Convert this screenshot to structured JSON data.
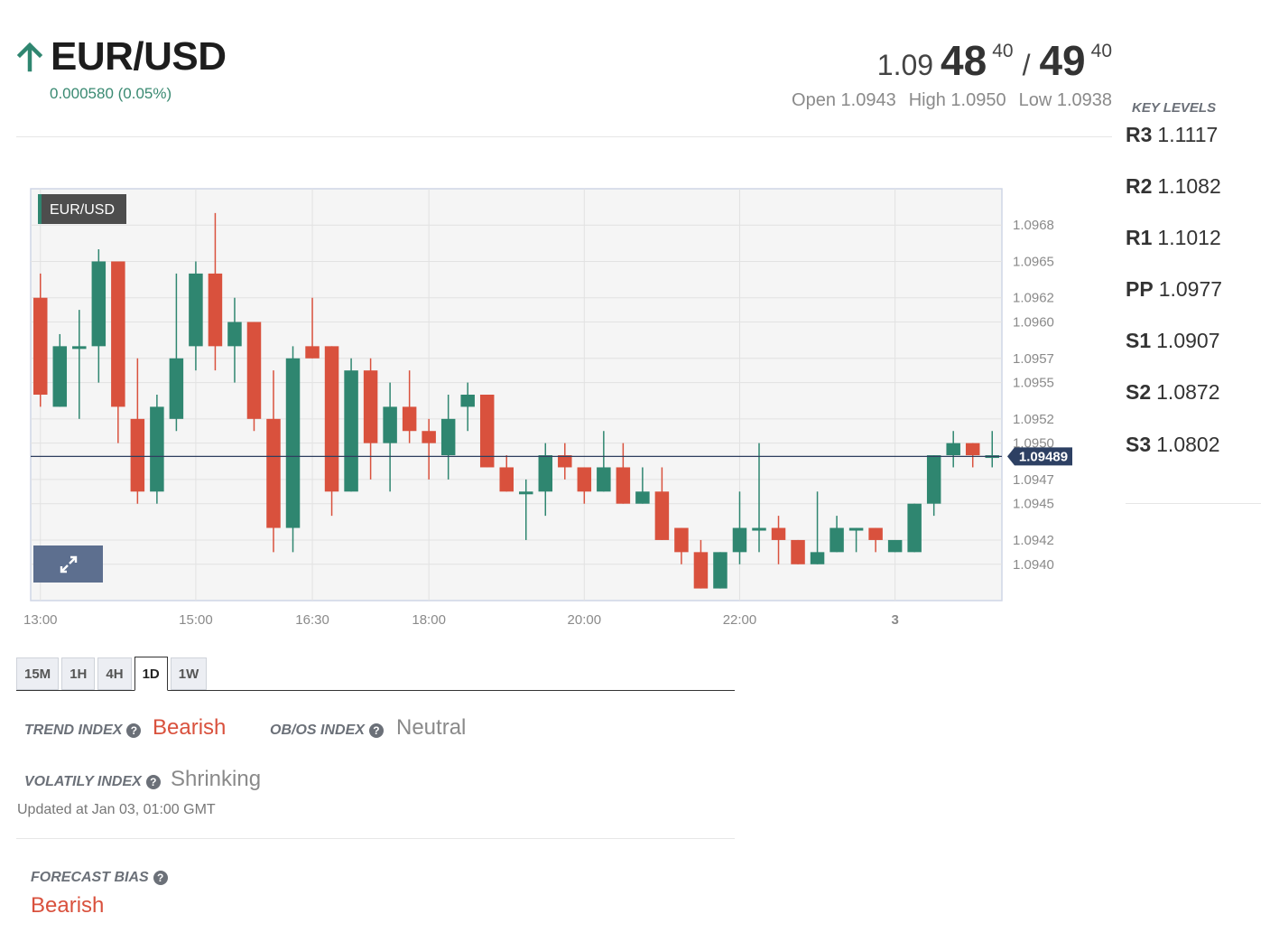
{
  "header": {
    "pair": "EUR/USD",
    "change": "0.000580 (0.05%)",
    "bid_prefix": "1.09",
    "bid_big": "48",
    "bid_sup": "40",
    "slash": "/",
    "ask_big": "49",
    "ask_sup": "40",
    "open": "Open 1.0943",
    "high": "High 1.0950",
    "low": "Low 1.0938"
  },
  "key_levels": {
    "title": "KEY LEVELS",
    "levels": [
      {
        "name": "R3",
        "value": "1.1117"
      },
      {
        "name": "R2",
        "value": "1.1082"
      },
      {
        "name": "R1",
        "value": "1.1012"
      },
      {
        "name": "PP",
        "value": "1.0977"
      },
      {
        "name": "S1",
        "value": "1.0907"
      },
      {
        "name": "S2",
        "value": "1.0872"
      },
      {
        "name": "S3",
        "value": "1.0802"
      }
    ]
  },
  "chart_data": {
    "type": "candlestick",
    "symbol_label": "EUR/USD",
    "current_price_label": "1.09489",
    "current_price": 1.09489,
    "ylim": [
      1.0937,
      1.0971
    ],
    "y_ticks": [
      "1.0968",
      "1.0965",
      "1.0962",
      "1.0960",
      "1.0957",
      "1.0955",
      "1.0952",
      "1.0950",
      "1.0947",
      "1.0945",
      "1.0942",
      "1.0940"
    ],
    "x_ticks": [
      {
        "label": "13:00",
        "index": 0.5
      },
      {
        "label": "15:00",
        "index": 8.5
      },
      {
        "label": "16:30",
        "index": 14.5
      },
      {
        "label": "18:00",
        "index": 20.5
      },
      {
        "label": "20:00",
        "index": 28.5
      },
      {
        "label": "22:00",
        "index": 36.5
      },
      {
        "label": "3",
        "index": 44.5
      }
    ],
    "grid": true,
    "up_color": "#2f8670",
    "down_color": "#d9513d",
    "candles": [
      {
        "o": 1.0962,
        "h": 1.0964,
        "l": 1.0953,
        "c": 1.0954
      },
      {
        "o": 1.0953,
        "h": 1.0959,
        "l": 1.0953,
        "c": 1.0958
      },
      {
        "o": 1.0958,
        "h": 1.0961,
        "l": 1.0952,
        "c": 1.0958
      },
      {
        "o": 1.0958,
        "h": 1.0966,
        "l": 1.0955,
        "c": 1.0965
      },
      {
        "o": 1.0965,
        "h": 1.0965,
        "l": 1.095,
        "c": 1.0953
      },
      {
        "o": 1.0952,
        "h": 1.0957,
        "l": 1.0945,
        "c": 1.0946
      },
      {
        "o": 1.0946,
        "h": 1.0954,
        "l": 1.0945,
        "c": 1.0953
      },
      {
        "o": 1.0952,
        "h": 1.0964,
        "l": 1.0951,
        "c": 1.0957
      },
      {
        "o": 1.0958,
        "h": 1.0965,
        "l": 1.0956,
        "c": 1.0964
      },
      {
        "o": 1.0964,
        "h": 1.0969,
        "l": 1.0956,
        "c": 1.0958
      },
      {
        "o": 1.0958,
        "h": 1.0962,
        "l": 1.0955,
        "c": 1.096
      },
      {
        "o": 1.096,
        "h": 1.096,
        "l": 1.0951,
        "c": 1.0952
      },
      {
        "o": 1.0952,
        "h": 1.0956,
        "l": 1.0941,
        "c": 1.0943
      },
      {
        "o": 1.0943,
        "h": 1.0958,
        "l": 1.0941,
        "c": 1.0957
      },
      {
        "o": 1.0958,
        "h": 1.0962,
        "l": 1.0957,
        "c": 1.0957
      },
      {
        "o": 1.0958,
        "h": 1.0958,
        "l": 1.0944,
        "c": 1.0946
      },
      {
        "o": 1.0946,
        "h": 1.0957,
        "l": 1.0946,
        "c": 1.0956
      },
      {
        "o": 1.0956,
        "h": 1.0957,
        "l": 1.0947,
        "c": 1.095
      },
      {
        "o": 1.095,
        "h": 1.0955,
        "l": 1.0946,
        "c": 1.0953
      },
      {
        "o": 1.0953,
        "h": 1.0956,
        "l": 1.095,
        "c": 1.0951
      },
      {
        "o": 1.0951,
        "h": 1.0952,
        "l": 1.0947,
        "c": 1.095
      },
      {
        "o": 1.0949,
        "h": 1.0954,
        "l": 1.0947,
        "c": 1.0952
      },
      {
        "o": 1.0953,
        "h": 1.0955,
        "l": 1.0951,
        "c": 1.0954
      },
      {
        "o": 1.0954,
        "h": 1.0954,
        "l": 1.0948,
        "c": 1.0948
      },
      {
        "o": 1.0948,
        "h": 1.0949,
        "l": 1.0946,
        "c": 1.0946
      },
      {
        "o": 1.0946,
        "h": 1.0947,
        "l": 1.0942,
        "c": 1.0946
      },
      {
        "o": 1.0946,
        "h": 1.095,
        "l": 1.0944,
        "c": 1.0949
      },
      {
        "o": 1.0949,
        "h": 1.095,
        "l": 1.0947,
        "c": 1.0948
      },
      {
        "o": 1.0948,
        "h": 1.0948,
        "l": 1.0945,
        "c": 1.0946
      },
      {
        "o": 1.0946,
        "h": 1.0951,
        "l": 1.0946,
        "c": 1.0948
      },
      {
        "o": 1.0948,
        "h": 1.095,
        "l": 1.0945,
        "c": 1.0945
      },
      {
        "o": 1.0945,
        "h": 1.0948,
        "l": 1.0945,
        "c": 1.0946
      },
      {
        "o": 1.0946,
        "h": 1.0948,
        "l": 1.0942,
        "c": 1.0942
      },
      {
        "o": 1.0943,
        "h": 1.0943,
        "l": 1.094,
        "c": 1.0941
      },
      {
        "o": 1.0941,
        "h": 1.0942,
        "l": 1.0938,
        "c": 1.0938
      },
      {
        "o": 1.0938,
        "h": 1.0941,
        "l": 1.0938,
        "c": 1.0941
      },
      {
        "o": 1.0941,
        "h": 1.0946,
        "l": 1.094,
        "c": 1.0943
      },
      {
        "o": 1.0943,
        "h": 1.095,
        "l": 1.0941,
        "c": 1.0943
      },
      {
        "o": 1.0943,
        "h": 1.0944,
        "l": 1.094,
        "c": 1.0942
      },
      {
        "o": 1.0942,
        "h": 1.0942,
        "l": 1.094,
        "c": 1.094
      },
      {
        "o": 1.094,
        "h": 1.0946,
        "l": 1.094,
        "c": 1.0941
      },
      {
        "o": 1.0941,
        "h": 1.0944,
        "l": 1.0941,
        "c": 1.0943
      },
      {
        "o": 1.0943,
        "h": 1.0943,
        "l": 1.0941,
        "c": 1.0943
      },
      {
        "o": 1.0943,
        "h": 1.0943,
        "l": 1.0941,
        "c": 1.0942
      },
      {
        "o": 1.0941,
        "h": 1.0942,
        "l": 1.0941,
        "c": 1.0942
      },
      {
        "o": 1.0941,
        "h": 1.0945,
        "l": 1.0941,
        "c": 1.0945
      },
      {
        "o": 1.0945,
        "h": 1.0949,
        "l": 1.0944,
        "c": 1.0949
      },
      {
        "o": 1.0949,
        "h": 1.0951,
        "l": 1.0948,
        "c": 1.095
      },
      {
        "o": 1.095,
        "h": 1.095,
        "l": 1.0948,
        "c": 1.0949
      },
      {
        "o": 1.0949,
        "h": 1.0951,
        "l": 1.0948,
        "c": 1.0949
      }
    ]
  },
  "timeframes": {
    "items": [
      "15M",
      "1H",
      "4H",
      "1D",
      "1W"
    ],
    "active": "1D"
  },
  "indices": {
    "trend_label": "TREND INDEX",
    "trend_value": "Bearish",
    "obos_label": "OB/OS INDEX",
    "obos_value": "Neutral",
    "volatility_label": "VOLATILY INDEX",
    "volatility_value": "Shrinking",
    "updated": "Updated at Jan 03, 01:00 GMT",
    "forecast_label": "FORECAST BIAS",
    "forecast_value": "Bearish",
    "help_glyph": "?"
  },
  "colors": {
    "accent_green": "#3a8a72",
    "bearish": "#d9513d",
    "expand_button": "#5d6f8f"
  },
  "icons": {
    "trend": "arrow-up-icon",
    "expand": "expand-icon",
    "help": "question-circle-icon"
  }
}
